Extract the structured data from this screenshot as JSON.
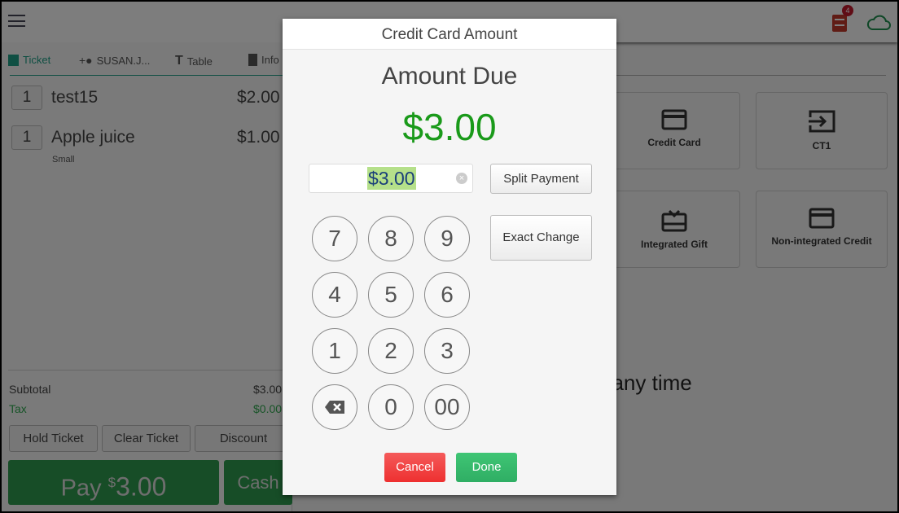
{
  "header": {
    "notification_count": "4",
    "accent": "#1e9e86"
  },
  "tabs": [
    {
      "label": "Ticket",
      "icon": "receipt-icon"
    },
    {
      "label": "SUSAN.J...",
      "icon": "add-person-icon"
    },
    {
      "label": "Table",
      "icon": "table-icon"
    },
    {
      "label": "Info",
      "icon": "add-document-icon"
    }
  ],
  "ticket_items": [
    {
      "qty": "1",
      "name": "test15",
      "price": "$2.00",
      "modifier": ""
    },
    {
      "qty": "1",
      "name": "Apple juice",
      "price": "$1.00",
      "modifier": "Small"
    }
  ],
  "totals": {
    "subtotal_label": "Subtotal",
    "subtotal": "$3.00",
    "tax_label": "Tax",
    "tax": "$0.00"
  },
  "actions": {
    "hold": "Hold Ticket",
    "clear": "Clear Ticket",
    "discount": "Discount",
    "pay_label": "Pay",
    "pay_currency": "$",
    "pay_amount": "3.00",
    "cash": "Cash"
  },
  "payment_tiles": [
    {
      "label": "Credit Card",
      "icon": "credit-card-icon"
    },
    {
      "label": "CT1",
      "icon": "input-icon"
    },
    {
      "label": "Integrated Gift",
      "icon": "gift-card-icon"
    },
    {
      "label": "Non-integrated Credit",
      "icon": "credit-card-icon"
    }
  ],
  "background_text": "t any time",
  "modal": {
    "title": "Credit Card Amount",
    "amount_due_label": "Amount Due",
    "amount_due": "$3.00",
    "input_value": "$3.00",
    "split_payment": "Split Payment",
    "exact_change": "Exact Change",
    "keys": [
      "7",
      "8",
      "9",
      "4",
      "5",
      "6",
      "1",
      "2",
      "3",
      "",
      "0",
      "00"
    ],
    "cancel": "Cancel",
    "done": "Done"
  },
  "colors": {
    "green": "#1a9a1a",
    "cancel": "#ef3e3e",
    "done": "#34b86a",
    "pay": "#2f9a4e"
  }
}
